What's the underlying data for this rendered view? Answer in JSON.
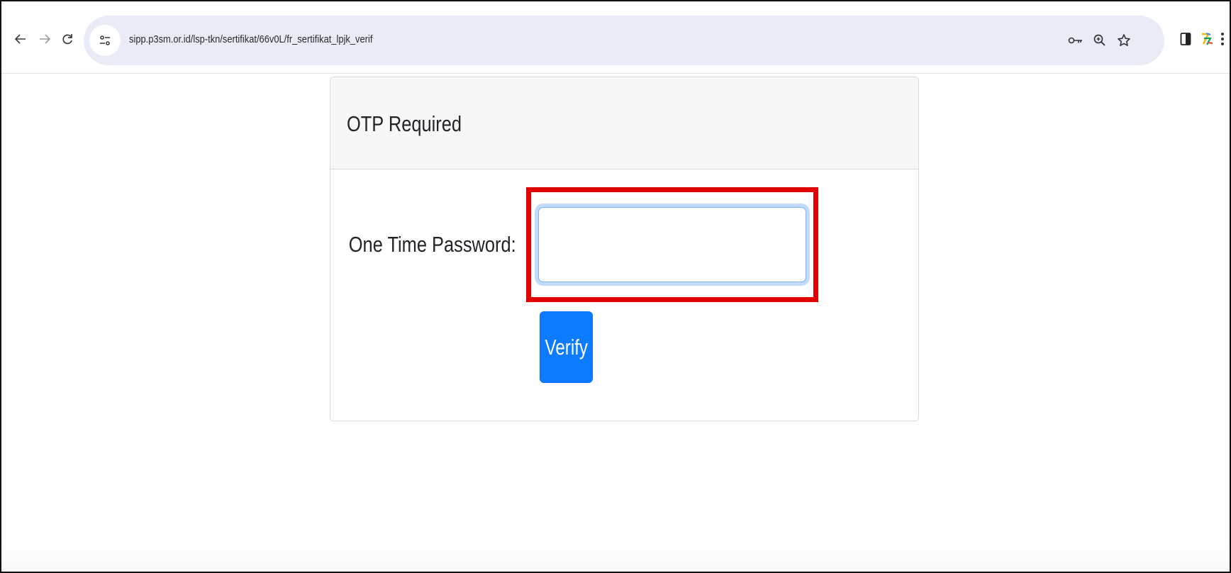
{
  "browser": {
    "url": "sipp.p3sm.or.id/lsp-tkn/sertifikat/66v0L/fr_sertifikat_lpjk_verif",
    "back_icon": "arrow-left-icon",
    "forward_icon": "arrow-right-icon",
    "reload_icon": "reload-icon",
    "site_info_icon": "tune-icon",
    "password_key_icon": "key-icon",
    "zoom_icon": "zoom-icon",
    "bookmark_icon": "star-icon",
    "sidebar_icon": "side-panel-icon",
    "extension_icon": "extension-icon",
    "menu_icon": "more-vert-icon"
  },
  "card": {
    "title": "OTP Required",
    "otp_label": "One Time Password:",
    "otp_value": "",
    "verify_label": "Verify"
  },
  "colors": {
    "accent": "#0d7bff",
    "highlight": "#e00000",
    "omnibox": "#e9ecf7"
  }
}
